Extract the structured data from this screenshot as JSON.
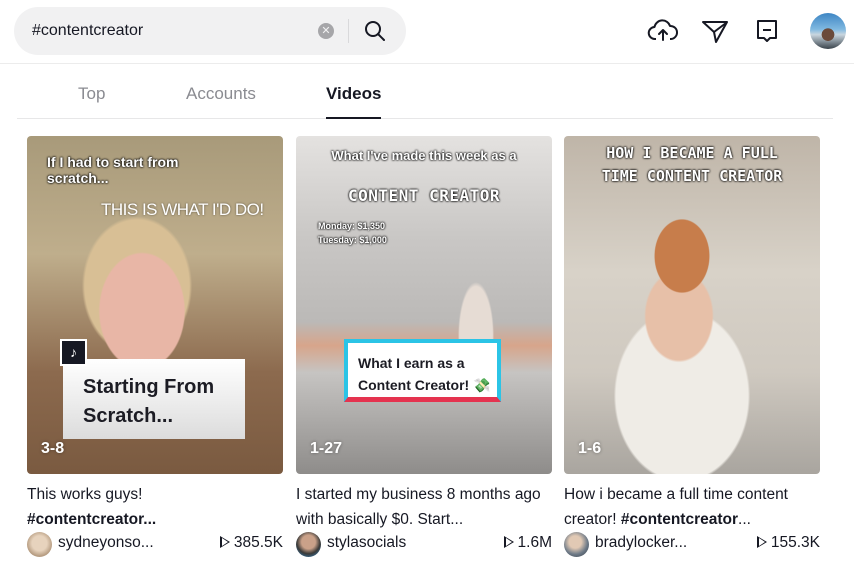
{
  "search": {
    "value": "#contentcreator",
    "clear_icon": "clear-circle-x",
    "search_icon": "magnifier"
  },
  "header_icons": [
    "upload-cloud",
    "paper-plane",
    "message-box",
    "user-avatar"
  ],
  "tabs": [
    {
      "label": "Top",
      "active": false
    },
    {
      "label": "Accounts",
      "active": false
    },
    {
      "label": "Videos",
      "active": true
    }
  ],
  "videos": [
    {
      "overlay_top": "If I had to start from scratch...",
      "overlay_sub": "THIS IS WHAT I'D DO!",
      "overlay_box": "Starting From Scratch...",
      "tiktok_badge": "♪",
      "date": "3-8",
      "description": "This works guys!",
      "description_tag": "#contentcreator...",
      "author": "sydneyonso...",
      "views": "385.5K"
    },
    {
      "overlay_top": "What I've made this week as a",
      "overlay_title": "CONTENT CREATOR",
      "overlay_lines": [
        "Monday: $1,350",
        "Tuesday: $1,000"
      ],
      "overlay_box_line1": "What I earn as a",
      "overlay_box_line2": "Content Creator! 💸",
      "date": "1-27",
      "description": "I started my business 8 months ago with basically $0. Start...",
      "author": "stylasocials",
      "views": "1.6M"
    },
    {
      "overlay_line1": "HOW I BECAME A FULL",
      "overlay_line2": "TIME CONTENT CREATOR",
      "date": "1-6",
      "description": "How i became a full time content creator! ",
      "description_tag": "#contentcreator",
      "description_tail": "...",
      "author": "bradylocker...",
      "views": "155.3K"
    }
  ],
  "colors": {
    "text_primary": "#161823",
    "text_secondary": "#8a8b91",
    "search_bg": "#f1f1f2",
    "accent_cyan": "#2bc4e6",
    "accent_red": "#e5334f"
  }
}
